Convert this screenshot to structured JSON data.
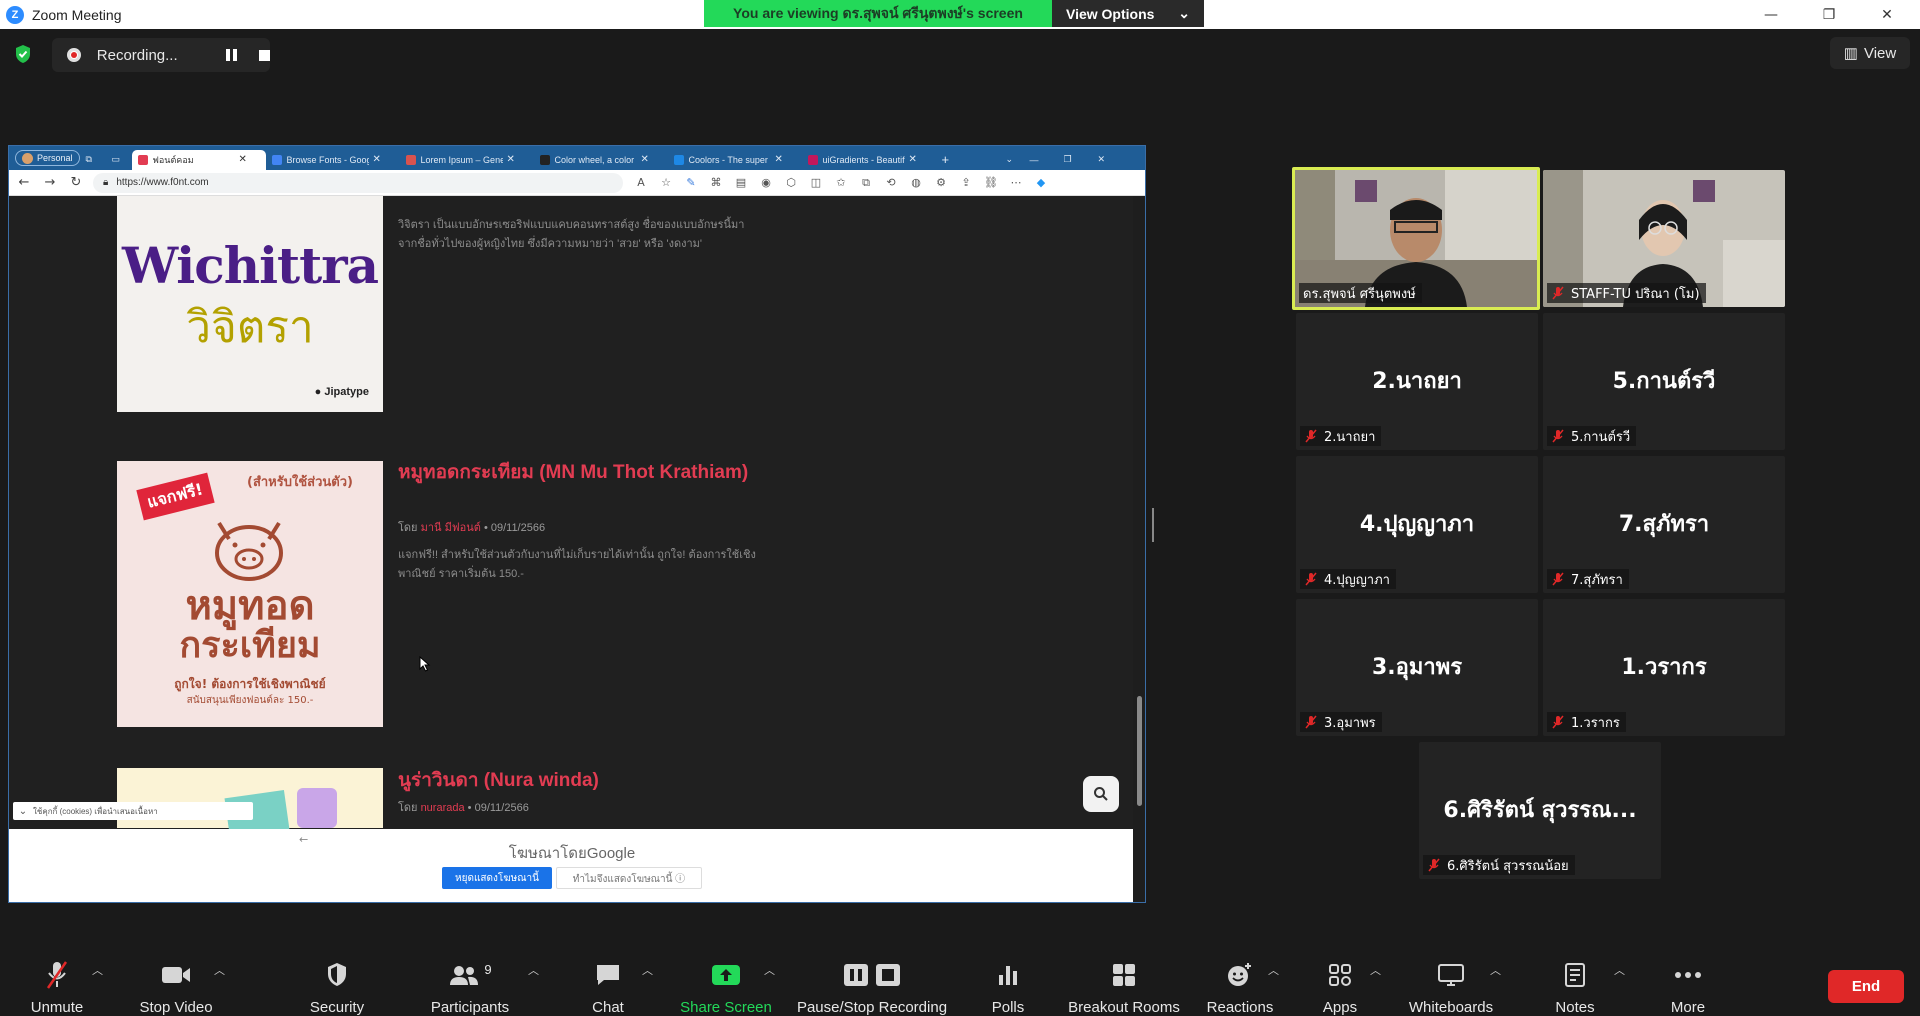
{
  "window": {
    "title": "Zoom Meeting",
    "logo_letter": "Z"
  },
  "banner": {
    "message": "You are viewing ดร.สุพจน์ ศรีนุตพงษ์'s screen",
    "options_label": "View Options"
  },
  "recording": {
    "label": "Recording..."
  },
  "view_button": {
    "label": "View"
  },
  "browser": {
    "profile": "Personal",
    "tabs": [
      {
        "label": "ฟอนต์คอม",
        "active": true,
        "color": "#e23c52"
      },
      {
        "label": "Browse Fonts - Goog",
        "color": "#4285f4"
      },
      {
        "label": "Lorem Ipsum – Gene",
        "color": "#d9534f"
      },
      {
        "label": "Color wheel, a color",
        "color": "#222222"
      },
      {
        "label": "Coolors - The super",
        "color": "#1e88e5"
      },
      {
        "label": "uiGradients - Beautif",
        "color": "#c2185b"
      }
    ],
    "url": "https://www.f0nt.com"
  },
  "page": {
    "card1": {
      "img_title": "Wichittra",
      "img_subtitle": "วิจิตรา",
      "img_brand": "Jipatype",
      "desc": "วิจิตรา เป็นแบบอักษรเซอริฟแบบแคบคอนทราสต์สูง ชื่อของแบบอักษรนี้มาจากชื่อทั่วไปของผู้หญิงไทย ซึ่งมีความหมายว่า 'สวย' หรือ 'งดงาม'"
    },
    "card2": {
      "title": "หมูทอดกระเทียม (MN Mu Thot Krathiam)",
      "meta_prefix": "โดย",
      "author": "มานี มีฟอนต์",
      "date": "• 09/11/2566",
      "desc": "แจกฟรี!! สำหรับใช้ส่วนตัวกับงานที่ไม่เก็บรายได้เท่านั้น ถูกใจ! ต้องการใช้เชิงพาณิชย์ ราคาเริ่มต้น 150.-",
      "img_badge": "แจกฟรี!",
      "img_top": "(สำหรับใช้ส่วนตัว)",
      "img_line1": "หมูทอด",
      "img_line2": "กระเทียม",
      "img_bottom": "ถูกใจ! ต้องการใช้เชิงพาณิชย์",
      "img_bottom2": "สนับสนุนเพียงฟอนต์ละ 150.-"
    },
    "card3": {
      "title": "นูร่าวินดา (Nura winda)",
      "meta_prefix": "โดย",
      "author": "nurarada",
      "date": "• 09/11/2566"
    },
    "cookie_text": "ใช้คุกกี้ (cookies) เพื่อนำเสนอเนื้อหา",
    "ad": {
      "label": "โฆษณาโดย",
      "brand": "Google",
      "stop_button": "หยุดแสดงโฆษณานี้",
      "why_button": "ทำไมจึงแสดงโฆษณานี้ ⓘ"
    }
  },
  "participants": {
    "video1": {
      "name": "ดร.สุพจน์ ศรีนุตพงษ์"
    },
    "video2": {
      "name": "STAFF-TU ปริณา (โม)"
    },
    "tiles": [
      {
        "center": "2.นาถยา",
        "tag": "2.นาถยา"
      },
      {
        "center": "5.กานต์รวี",
        "tag": "5.กานต์รวี"
      },
      {
        "center": "4.ปุญญาภา",
        "tag": "4.ปุญญาภา"
      },
      {
        "center": "7.สุภัทรา",
        "tag": "7.สุภัทรา"
      },
      {
        "center": "3.อุมาพร",
        "tag": "3.อุมาพร"
      },
      {
        "center": "1.วรากร",
        "tag": "1.วรากร"
      },
      {
        "center": "6.ศิริรัตน์  สุวรรณ...",
        "tag": "6.ศิริรัตน์  สุวรรณน้อย"
      }
    ]
  },
  "toolbar": {
    "unmute": "Unmute",
    "stop_video": "Stop Video",
    "security": "Security",
    "participants": "Participants",
    "participants_count": "9",
    "chat": "Chat",
    "share_screen": "Share Screen",
    "pause_stop_recording": "Pause/Stop Recording",
    "polls": "Polls",
    "breakout_rooms": "Breakout Rooms",
    "reactions": "Reactions",
    "apps": "Apps",
    "whiteboards": "Whiteboards",
    "notes": "Notes",
    "more": "More",
    "end": "End"
  },
  "colors": {
    "share_green": "#23d959",
    "end_red": "#e02828",
    "active_speaker": "#d9ec52",
    "font_red": "#e23c52"
  }
}
